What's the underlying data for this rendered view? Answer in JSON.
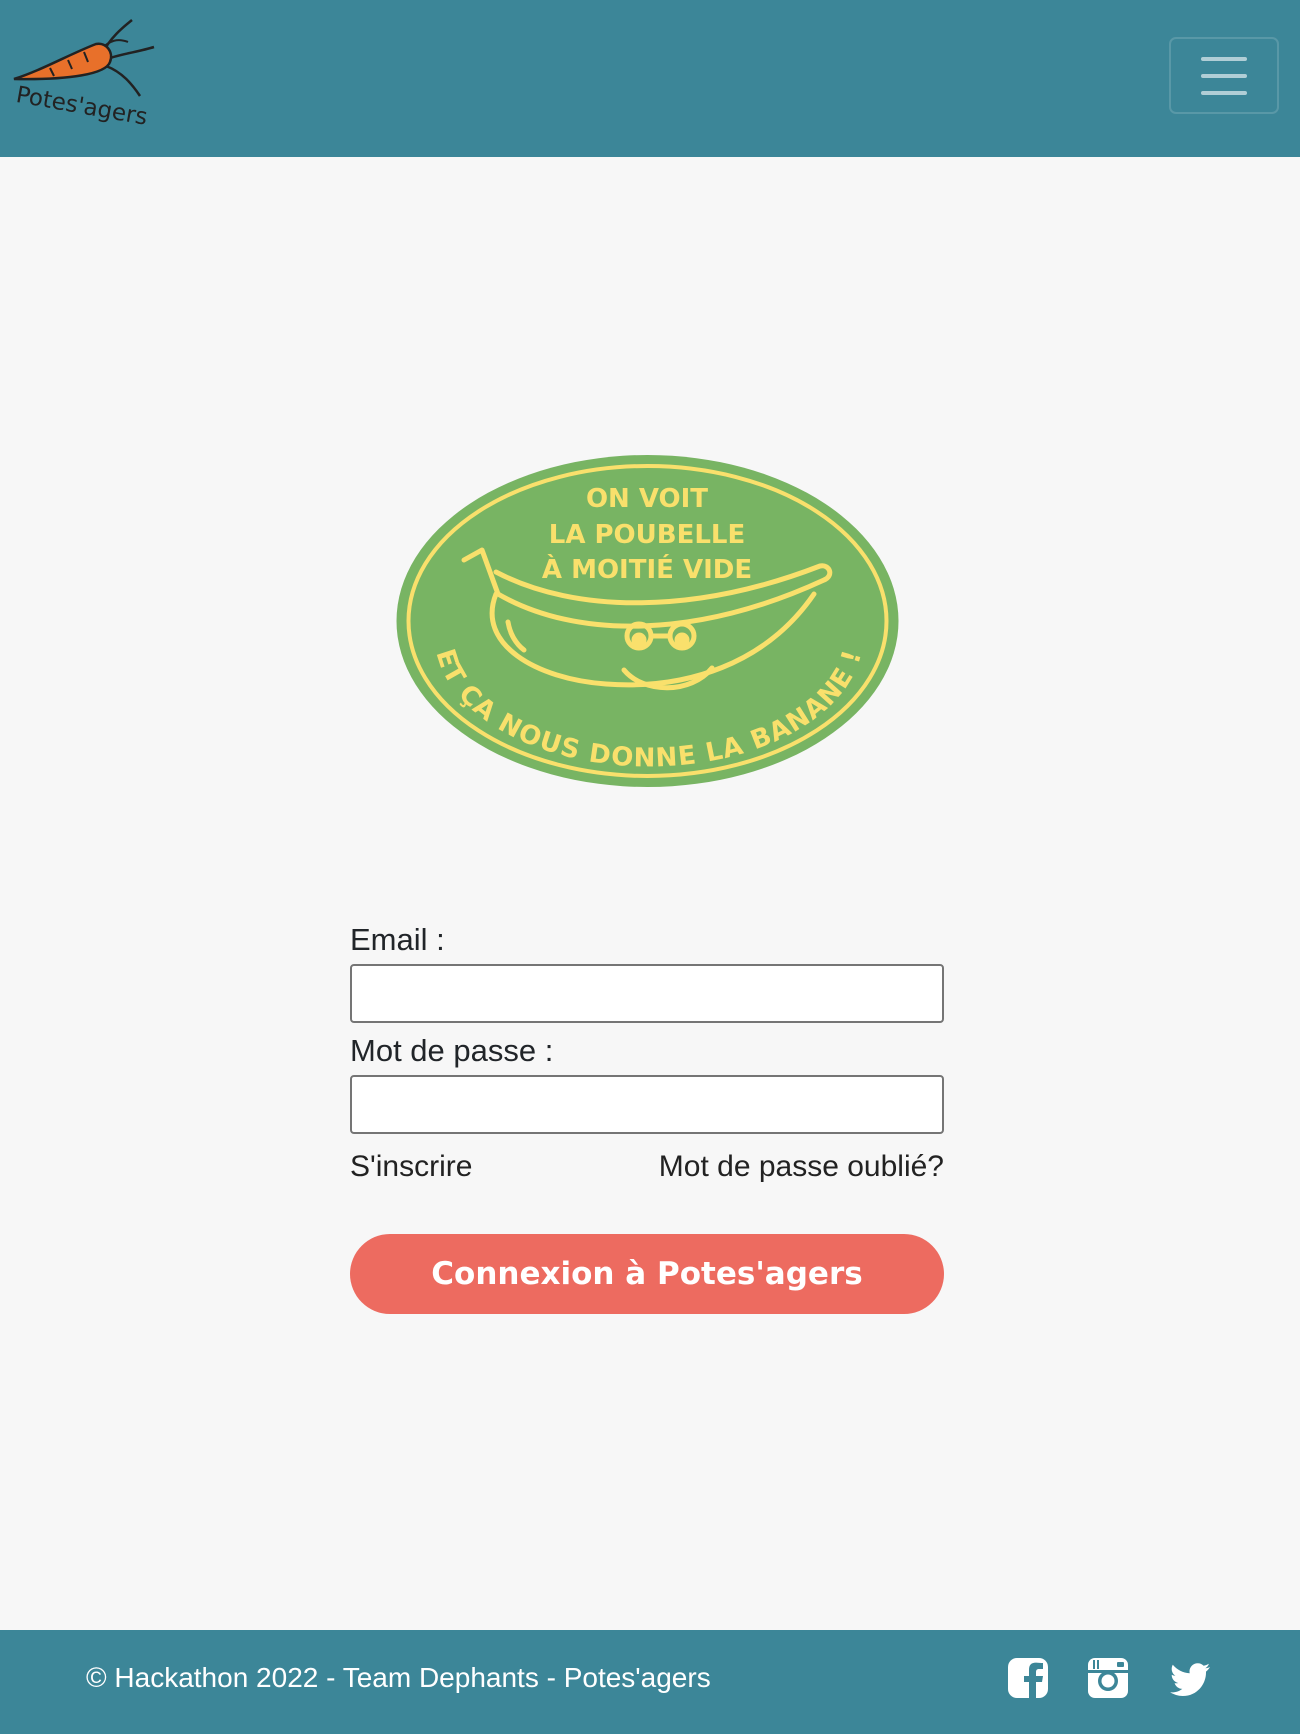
{
  "colors": {
    "header_bg": "#3c8698",
    "page_bg": "#f7f7f7",
    "button_bg": "#ed6b60",
    "badge_green": "#78b463",
    "badge_yellow": "#f9e06c",
    "carrot_orange": "#e8702a"
  },
  "header": {
    "logo_text": "Potes'agers",
    "menu_icon": "hamburger-icon"
  },
  "badge": {
    "top_lines": [
      "ON VOIT",
      "LA POUBELLE",
      "À MOITIÉ VIDE"
    ],
    "arc_text": "ET ÇA NOUS DONNE LA BANANE !"
  },
  "form": {
    "email_label": "Email :",
    "email_value": "",
    "password_label": "Mot de passe :",
    "password_value": "",
    "signup_link": "S'inscrire",
    "forgot_link": "Mot de passe oublié?",
    "submit_label": "Connexion à Potes'agers"
  },
  "footer": {
    "copyright": "© Hackathon 2022 - Team Dephants - Potes'agers",
    "social_icons": [
      "facebook-icon",
      "instagram-icon",
      "twitter-icon"
    ]
  }
}
